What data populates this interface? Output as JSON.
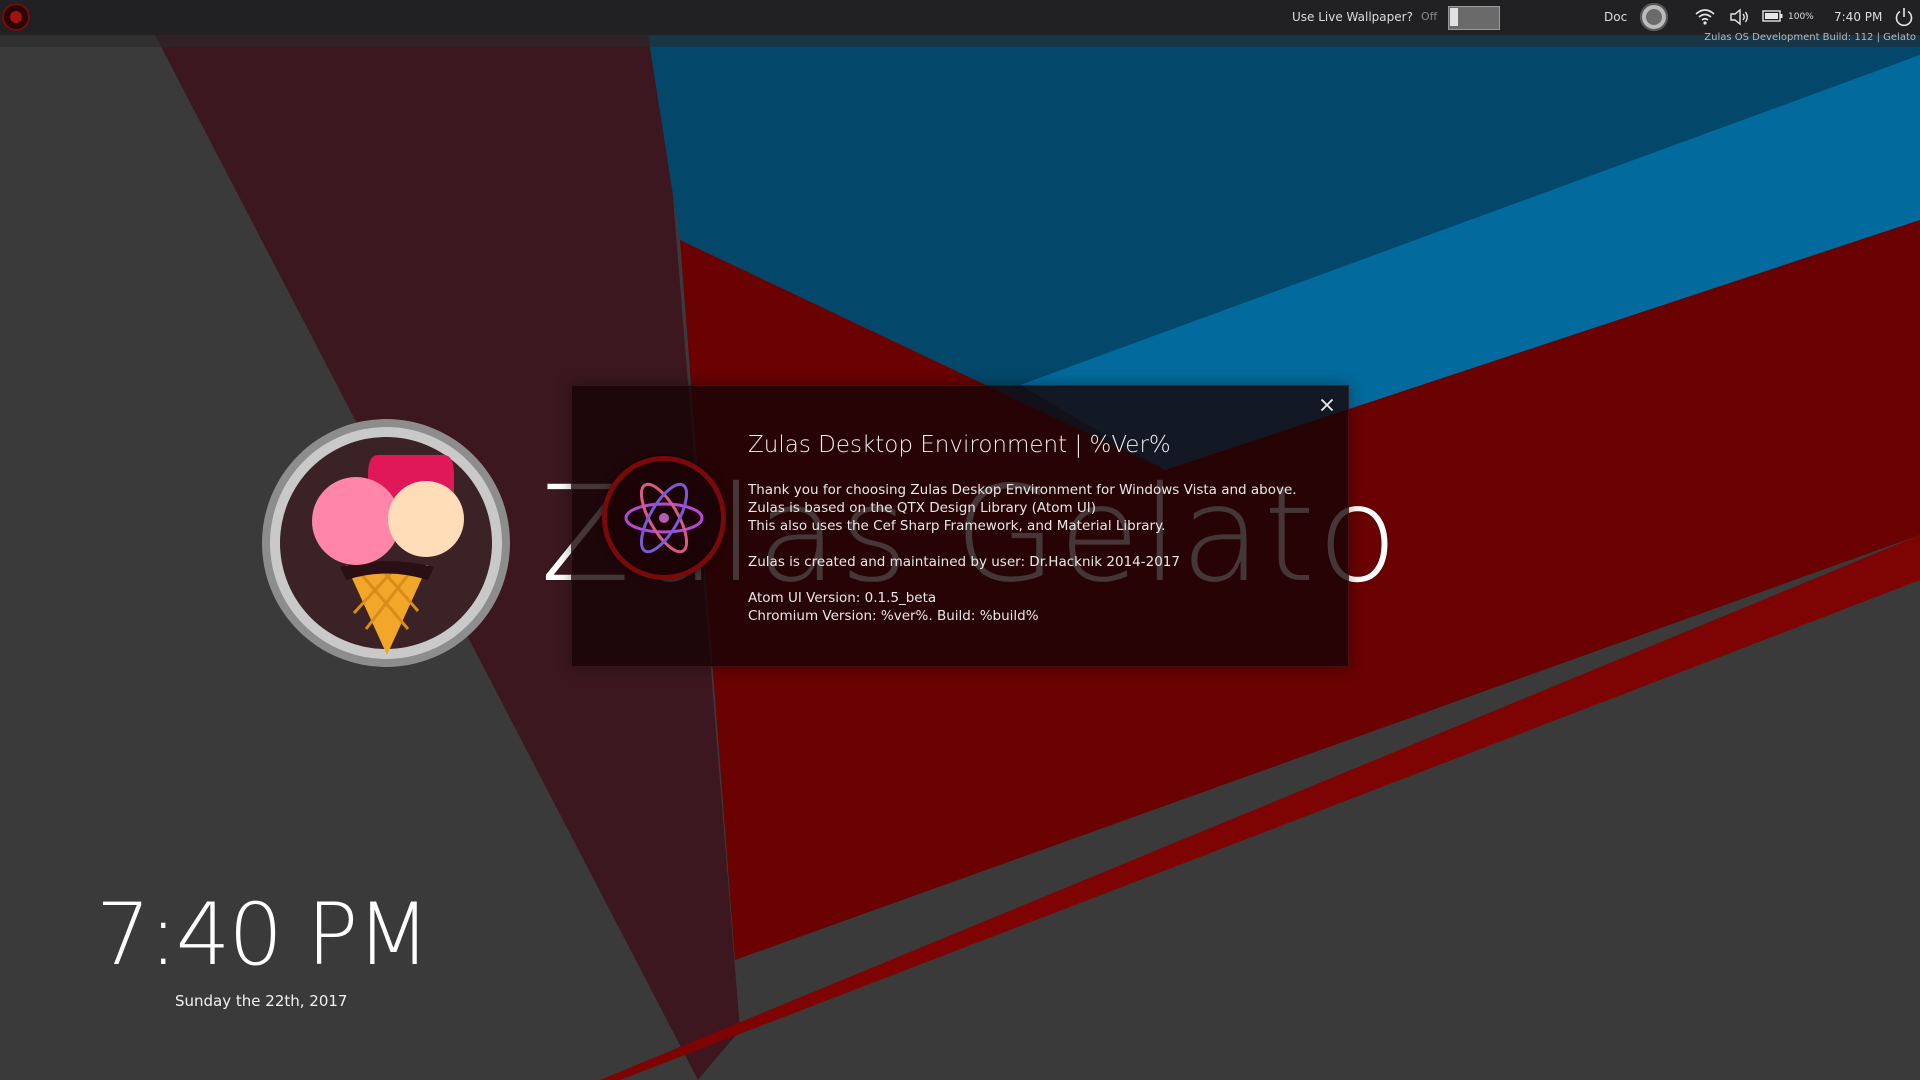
{
  "topbar": {
    "live_wallpaper_label": "Use Live Wallpaper?",
    "live_wallpaper_state": "Off",
    "user_name": "Doc",
    "battery_percent": "100%",
    "time": "7:40 PM",
    "build_info": "Zulas OS Development Build: 112 | Gelato",
    "icons": [
      "start-orb-icon",
      "user-avatar",
      "wifi-icon",
      "volume-icon",
      "battery-icon",
      "power-icon"
    ]
  },
  "desktop": {
    "brand_name": "Zulas Gelato",
    "clock_time": "7:40 PM",
    "clock_date": "Sunday the 22th, 2017"
  },
  "about_dialog": {
    "title": "Zulas Desktop Environment | %Ver%",
    "line1": "Thank you for choosing Zulas Deskop Environment for Windows Vista and above.",
    "line2": "Zulas is based on the QTX Design Library (Atom UI)",
    "line3": "This also uses the Cef Sharp Framework, and Material Library.",
    "line4": "Zulas is created and maintained by user: Dr.Hacknik 2014-2017",
    "line5": "Atom UI Version: 0.1.5_beta",
    "line6": "Chromium Version: %ver%. Build: %build%",
    "close_icon": "close-icon"
  },
  "colors": {
    "wall_gray": "#3b3a3a",
    "wall_maroon": "#3c1720",
    "wall_red": "#6a0202",
    "wall_blue_dark": "#03486b",
    "wall_blue": "#026a9c",
    "dialog_bg": "#160406",
    "accent_red": "#7a0a0a"
  }
}
